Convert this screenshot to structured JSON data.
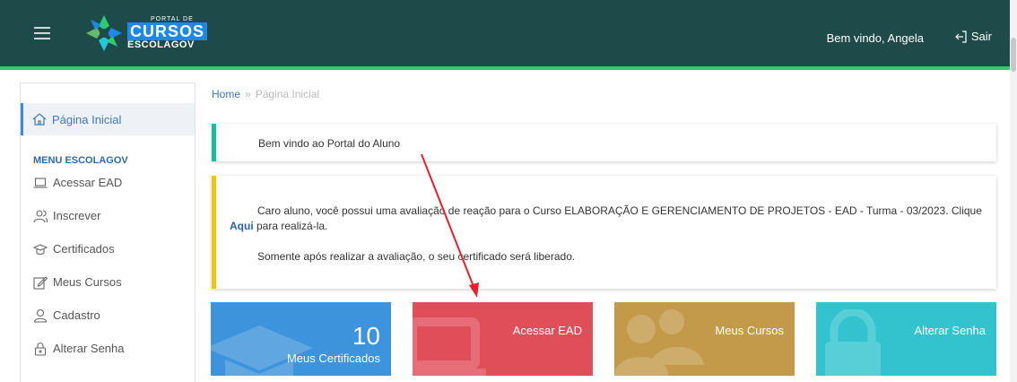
{
  "header": {
    "logo": {
      "line1": "PORTAL DE",
      "line2": "CURSOS",
      "line3": "ESCOLAGOV"
    },
    "welcome": "Bem vindo, Angela",
    "logout_label": "Sair",
    "bar_color": "#1f4a4a",
    "accent_color": "#2ecc71"
  },
  "sidebar": {
    "home_label": "Página Inicial",
    "heading": "MENU ESCOLAGOV",
    "items": [
      {
        "label": "Acessar EAD",
        "icon": "laptop-icon"
      },
      {
        "label": "Inscrever",
        "icon": "users-icon"
      },
      {
        "label": "Certificados",
        "icon": "graduation-cap-icon"
      },
      {
        "label": "Meus Cursos",
        "icon": "edit-icon"
      },
      {
        "label": "Cadastro",
        "icon": "user-icon"
      },
      {
        "label": "Alterar Senha",
        "icon": "lock-icon"
      }
    ]
  },
  "breadcrumb": {
    "home": "Home",
    "separator": "»",
    "current": "Página Inicial"
  },
  "welcome_panel": {
    "text": "Bem vindo ao Portal do Aluno"
  },
  "notice_panel": {
    "text_before_link": "Caro aluno, você possui uma avaliação de reação para o Curso ELABORAÇÃO E GERENCIAMENTO DE PROJETOS - EAD - Turma - 03/2023. Clique ",
    "link_text": "Aqui",
    "text_after_link": " para realizá-la.",
    "second_line": "Somente após realizar a avaliação, o seu certificado será liberado."
  },
  "tiles": [
    {
      "count": "10",
      "label": "Meus Certificados",
      "color": "#3d94dc"
    },
    {
      "label": "Acessar EAD",
      "color": "#e04e5a"
    },
    {
      "label": "Meus Cursos",
      "color": "#c39a4a"
    },
    {
      "label": "Alterar Senha",
      "color": "#33c3cf"
    }
  ],
  "annotation_color": "#e8202a"
}
